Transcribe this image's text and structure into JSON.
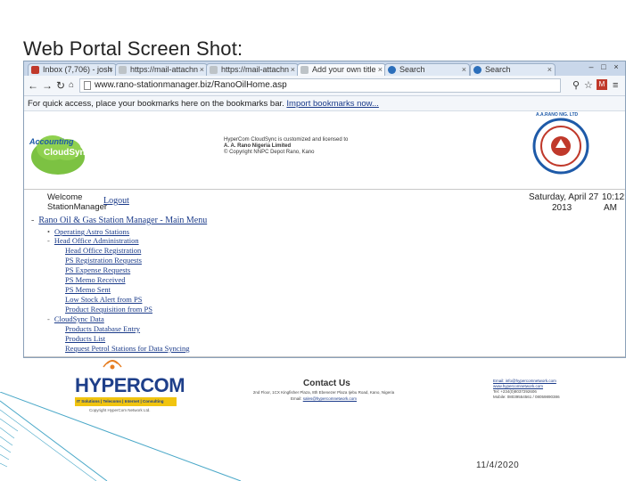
{
  "slide": {
    "title": "Web Portal Screen Shot:",
    "date": "11/4/2020"
  },
  "browser": {
    "tabs": [
      {
        "label": "Inbox (7,706) - josh",
        "color": "#c0392b"
      },
      {
        "label": "https://mail-attachn",
        "color": "#7f8c8d"
      },
      {
        "label": "https://mail-attachn",
        "color": "#7f8c8d"
      },
      {
        "label": "Add your own title",
        "color": "#7f8c8d"
      },
      {
        "label": "Search",
        "color": "#2c6fbb"
      },
      {
        "label": "Search",
        "color": "#2c6fbb"
      }
    ],
    "url": "www.rano-stationmanager.biz/RanoOilHome.asp",
    "bookmarks_text": "For quick access, place your bookmarks here on the bookmarks bar. ",
    "bookmarks_link": "Import bookmarks now..."
  },
  "header": {
    "accounting_logo_top": "Accounting",
    "accounting_logo_bottom": "CloudSync",
    "license_line1": "HyperCom CloudSync is customized and licensed to",
    "license_line2": "A. A. Rano Nigeria Limited",
    "license_line3": "© Copyright NNPC Depot Rano, Kano",
    "rano_logo_text": "A.A.RANO NIG. LTD"
  },
  "welcome": {
    "line1": "Welcome",
    "line2": "StationManager",
    "logout": "Logout",
    "date": "Saturday, April 27",
    "year": "2013",
    "time": "10:12:03",
    "ampm": "AM"
  },
  "menu": {
    "root": "Rano Oil & Gas Station Manager - Main Menu",
    "sections": [
      {
        "label": "Operating Astro Stations",
        "items": []
      },
      {
        "label": "Head Office Administration",
        "items": [
          "Head Office Registration",
          "PS Registration Requests",
          "PS Expense Requests",
          "PS Memo Received",
          "PS Memo Sent",
          "Low Stock Alert from PS",
          "Product Requisition from PS"
        ]
      },
      {
        "label": "CloudSync Data",
        "items": [
          "Products Database Entry",
          "Products List",
          "Request Petrol Stations for Data Syncing"
        ]
      }
    ]
  },
  "footer": {
    "logo_text": "HYPERCOM",
    "logo_tagline": "IT Solutions | Telecoms | Internet | Consulting",
    "copyright": "Copyright HyperCom Network Ltd.",
    "contact_title": "Contact Us",
    "contact_address": "2nd Floor, 1CX Kingfisher Plaza, 8th Ebenezer Plaza Ijebu Road, Kano, Nigeria",
    "contact_email_label": "Email: ",
    "contact_email": "sales@hypercomnetwork.com",
    "right_email": "Email: info@hypercomnetwork.com",
    "right_web": "www.hypercomnetwork.com",
    "right_tel": "Tel: +234(0)8037292606",
    "right_cell": "Mobile: 08039554561 / 08059890386"
  }
}
